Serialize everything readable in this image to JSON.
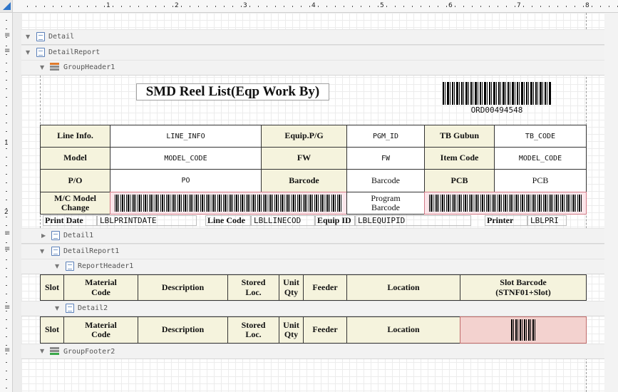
{
  "ruler": {
    "numbers": [
      "1",
      "2",
      "3",
      "4",
      "5",
      "6",
      "7",
      "8"
    ],
    "vnumbers": [
      "1",
      "2"
    ]
  },
  "bands": {
    "detail": "Detail",
    "detail_report": "DetailReport",
    "group_header1": "GroupHeader1",
    "detail1": "Detail1",
    "detail_report1": "DetailReport1",
    "report_header1": "ReportHeader1",
    "detail2": "Detail2",
    "group_footer2": "GroupFooter2"
  },
  "header": {
    "title": "SMD Reel List(Eqp Work By)",
    "barcode_text": "ORD00494548"
  },
  "info_table": {
    "row1": {
      "l1": "Line Info.",
      "v1": "LINE_INFO",
      "l2": "Equip.P/G",
      "v2": "PGM_ID",
      "l3": "TB Gubun",
      "v3": "TB_CODE"
    },
    "row2": {
      "l1": "Model",
      "v1": "MODEL_CODE",
      "l2": "FW",
      "v2": "FW",
      "l3": "Item Code",
      "v3": "MODEL_CODE"
    },
    "row3": {
      "l1": "P/O",
      "v1": "PO",
      "l2": "Barcode",
      "v2": "Barcode",
      "l3": "PCB",
      "v3": "PCB"
    },
    "row4": {
      "l1a": "M/C Model",
      "l1b": "Change",
      "v2a": "Program",
      "v2b": "Barcode"
    }
  },
  "print_row": {
    "print_date_label": "Print Date",
    "print_date_value": "LBLPRINTDATE",
    "line_code_label": "Line Code",
    "line_code_value": "LBLLINECOD",
    "equip_id_label": "Equip ID",
    "equip_id_value": "LBLEQUIPID",
    "printer_label": "Printer",
    "printer_value": "LBLPRI"
  },
  "report_header_cols": {
    "slot": "Slot",
    "material_a": "Material",
    "material_b": "Code",
    "description": "Description",
    "stored_a": "Stored",
    "stored_b": "Loc.",
    "unit_a": "Unit",
    "unit_b": "Qty",
    "feeder": "Feeder",
    "location": "Location",
    "slot_barcode_a": "Slot Barcode",
    "slot_barcode_b": "(STNF01+Slot)"
  },
  "detail2_cols": {
    "slot": "Slot",
    "material_a": "Material",
    "material_b": "Code",
    "description": "Description",
    "stored_a": "Stored",
    "stored_b": "Loc.",
    "unit_a": "Unit",
    "unit_b": "Qty",
    "feeder": "Feeder",
    "location": "Location"
  },
  "colors": {
    "label_bg": "#f5f3dd",
    "barcode_pink": "#fbe6ea",
    "accent": "#2d74c9"
  }
}
